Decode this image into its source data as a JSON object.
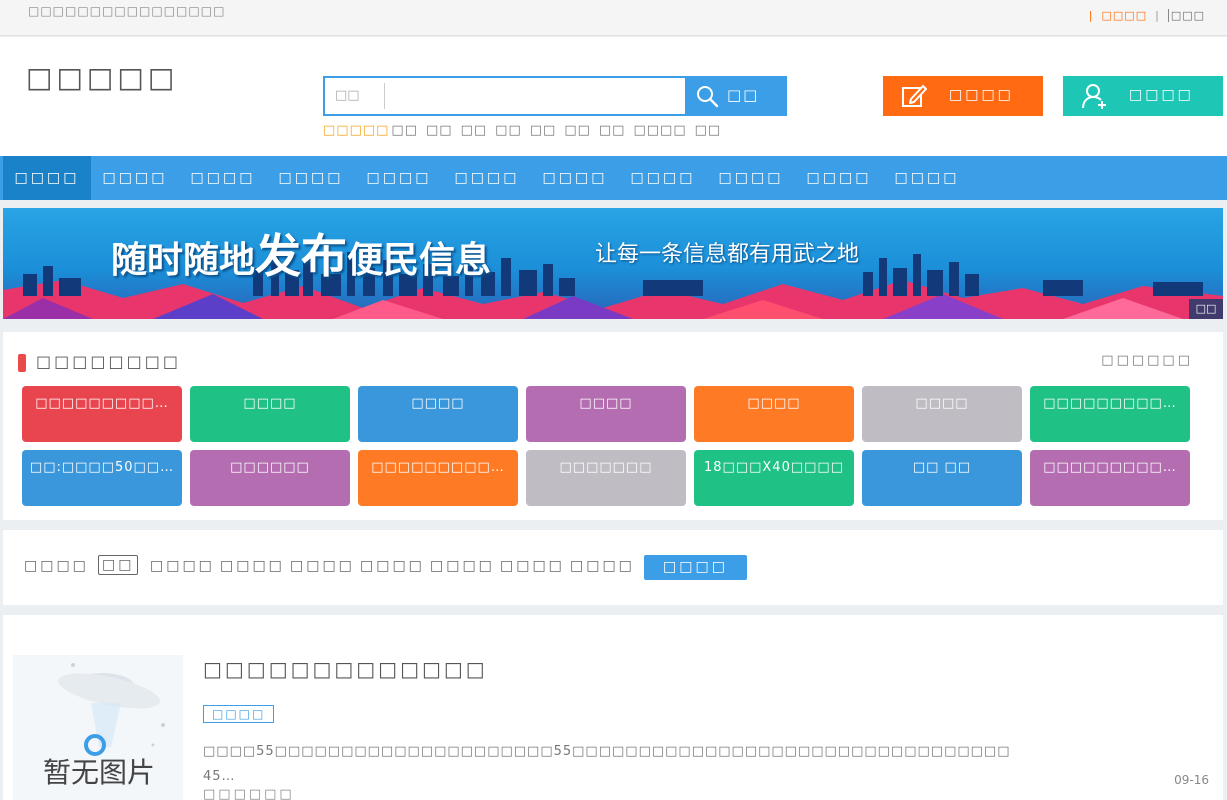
{
  "topbar": {
    "welcome": "□□□□□□□□□□□□□□□□",
    "login": "□□□□",
    "register": "□□□"
  },
  "header": {
    "logo": "□□□□□",
    "search": {
      "category": "□□",
      "button": "□□",
      "placeholder": ""
    },
    "hot_label": "□□□□□",
    "hot_words": [
      "□□",
      "□□",
      "□□",
      "□□",
      "□□",
      "□□",
      "□□",
      "□□□□",
      "□□"
    ],
    "publish_button": "□□□□",
    "user_button": "□□□□"
  },
  "nav": {
    "items": [
      "□□□□",
      "□□□□",
      "□□□□",
      "□□□□",
      "□□□□",
      "□□□□",
      "□□□□",
      "□□□□",
      "□□□□",
      "□□□□",
      "□□□□"
    ]
  },
  "banner": {
    "slogan_a": "随时随地",
    "slogan_b": "发布",
    "slogan_c": "便民信息",
    "subslogan": "让每一条信息都有用武之地",
    "tag": "□□"
  },
  "featured": {
    "title": "□□□□□□□□",
    "more": "□□□□□□",
    "tiles": [
      {
        "label": "□□□□□□□□□…",
        "color": "#e9454e"
      },
      {
        "label": "□□□□",
        "color": "#20c185"
      },
      {
        "label": "□□□□",
        "color": "#3a97dc"
      },
      {
        "label": "□□□□",
        "color": "#b36db0"
      },
      {
        "label": "□□□□",
        "color": "#ff7a25"
      },
      {
        "label": "□□□□",
        "color": "#bfbcc3"
      },
      {
        "label": "□□□□□□□□□…",
        "color": "#20c185"
      },
      {
        "label": "□□:□□□□50□□…",
        "color": "#3a97dc"
      },
      {
        "label": "□□□□□□",
        "color": "#b36db0"
      },
      {
        "label": "□□□□□□□□□…",
        "color": "#ff7a25"
      },
      {
        "label": "□□□□□□□",
        "color": "#bfbcc3"
      },
      {
        "label": "18□□□X40□□□□",
        "color": "#20c185"
      },
      {
        "label": "□□ □□",
        "color": "#3a97dc"
      },
      {
        "label": "□□□□□□□□□…",
        "color": "#b36db0"
      }
    ]
  },
  "filters": {
    "items": [
      "□□□□",
      "□□",
      "□□□□",
      "□□□□",
      "□□□□",
      "□□□□",
      "□□□□",
      "□□□□",
      "□□□□"
    ],
    "button": "□□□□"
  },
  "listing": {
    "no_image": "暂无图片",
    "title": "□□□□□□□□□□□□□",
    "tag": "□□□□",
    "desc_line1": "□□□□55□□□□□□□□□□□□□□□□□□□□□55□□□□□□□□□□□□□□□□□□□□□□□□□□□□□□□□□",
    "desc_line2": "45…",
    "date": "09-16",
    "meta": "□□□□□□"
  }
}
